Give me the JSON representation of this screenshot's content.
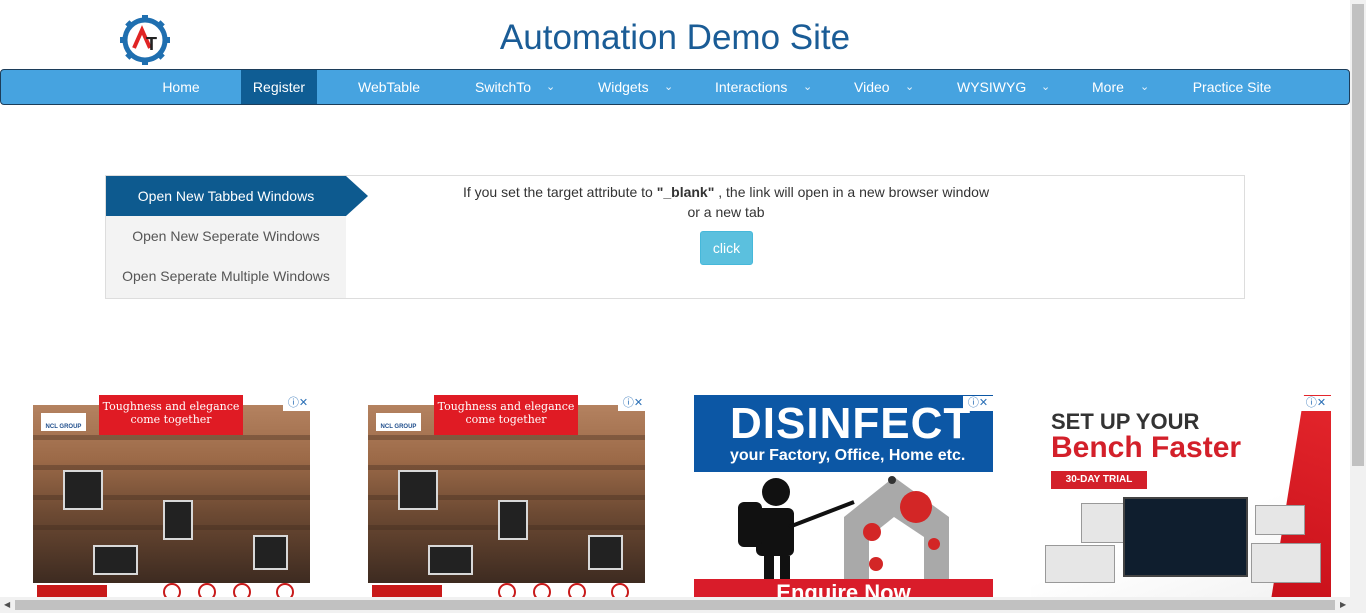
{
  "header": {
    "title": "Automation Demo Site",
    "logo_icon": "gear-logo-icon"
  },
  "nav": {
    "items": [
      {
        "label": "Home",
        "dropdown": false,
        "active": false
      },
      {
        "label": "Register",
        "dropdown": false,
        "active": true
      },
      {
        "label": "WebTable",
        "dropdown": false,
        "active": false
      },
      {
        "label": "SwitchTo",
        "dropdown": true,
        "active": false
      },
      {
        "label": "Widgets",
        "dropdown": true,
        "active": false
      },
      {
        "label": "Interactions",
        "dropdown": true,
        "active": false
      },
      {
        "label": "Video",
        "dropdown": true,
        "active": false
      },
      {
        "label": "WYSIWYG",
        "dropdown": true,
        "active": false
      },
      {
        "label": "More",
        "dropdown": true,
        "active": false
      },
      {
        "label": "Practice Site",
        "dropdown": false,
        "active": false
      }
    ],
    "chevron": "⌄"
  },
  "windows": {
    "tabs": [
      {
        "label": "Open New Tabbed Windows",
        "active": true
      },
      {
        "label": "Open New Seperate Windows",
        "active": false
      },
      {
        "label": "Open Seperate Multiple Windows",
        "active": false
      }
    ],
    "description_prefix": "If you set the target attribute to ",
    "description_code": "\"_blank\"",
    "description_suffix": " , the link will open in a new browser window or a new tab",
    "button_label": "click"
  },
  "ads": {
    "house": {
      "headline_1": "Toughness and elegance",
      "headline_2": "come together",
      "logo_text": "NCL GROUP"
    },
    "disinfect": {
      "headline": "DISINFECT",
      "subline": "your Factory, Office, Home etc.",
      "cta": "Enquire Now"
    },
    "bench": {
      "line1": "SET UP YOUR",
      "line2": "Bench Faster",
      "trial": "30-DAY TRIAL"
    },
    "adchoice_label": "ⓘ✕"
  },
  "colors": {
    "nav_bg": "#46a3e0",
    "nav_active": "#0f5d94",
    "title": "#1a5c96",
    "tab_active": "#0d5a8f",
    "button": "#5bc0de"
  }
}
